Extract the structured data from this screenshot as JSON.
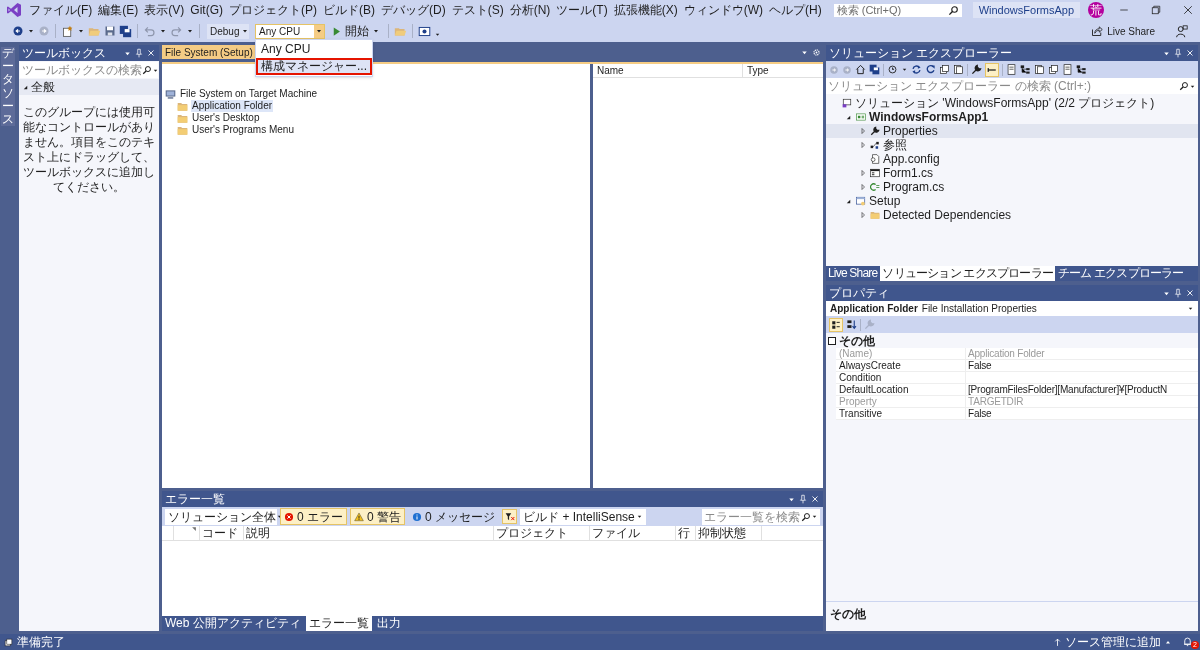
{
  "title_bar": {
    "menu": [
      "ファイル(F)",
      "編集(E)",
      "表示(V)",
      "Git(G)",
      "プロジェクト(P)",
      "ビルド(B)",
      "デバッグ(D)",
      "テスト(S)",
      "分析(N)",
      "ツール(T)",
      "拡張機能(X)",
      "ウィンドウ(W)",
      "ヘルプ(H)"
    ],
    "search_placeholder": "検索 (Ctrl+Q)",
    "solution_name": "WindowsFormsApp",
    "avatar": "荒"
  },
  "toolbar": {
    "configuration": "Debug",
    "platform": "Any CPU",
    "start": "開始",
    "live_share": "Live Share"
  },
  "platform_menu": [
    {
      "label": "Any CPU",
      "selected": false
    },
    {
      "label": "構成マネージャー...",
      "selected": true
    }
  ],
  "side_tab": "データソース",
  "toolbox": {
    "title": "ツールボックス",
    "search_placeholder": "ツールボックスの検索",
    "group": "全般",
    "message": "このグループには使用可能なコントロールがありません。項目をこのテキスト上にドラッグして、ツールボックスに追加してください。"
  },
  "document": {
    "tab": "File System (Setup)",
    "tree": {
      "label": "File System on Target Machine",
      "kind": "computer",
      "selected": false,
      "children": [
        {
          "label": "Application Folder",
          "kind": "folder",
          "selected": true
        },
        {
          "label": "User's Desktop",
          "kind": "folder",
          "selected": false
        },
        {
          "label": "User's Programs Menu",
          "kind": "folder",
          "selected": false
        }
      ]
    },
    "columns": [
      "Name",
      "Type"
    ]
  },
  "error_list": {
    "title": "エラー一覧",
    "scope": "ソリューション全体",
    "filters": [
      {
        "kind": "error",
        "label": "0 エラー",
        "on": true
      },
      {
        "kind": "warning",
        "label": "0 警告",
        "on": true
      },
      {
        "kind": "info",
        "label": "0 メッセージ",
        "on": false
      }
    ],
    "filter_on": true,
    "source": "ビルド + IntelliSense",
    "search_placeholder": "エラー一覧を検索",
    "columns": [
      "コード",
      "説明",
      "プロジェクト",
      "ファイル",
      "行",
      "抑制状態"
    ],
    "tabs": [
      {
        "label": "Web 公開アクティビティ",
        "selected": false
      },
      {
        "label": "エラー一覧",
        "selected": true
      },
      {
        "label": "出力",
        "selected": false
      }
    ]
  },
  "solution_explorer": {
    "title": "ソリューション エクスプローラー",
    "search_placeholder": "ソリューション エクスプローラー の検索 (Ctrl+:)",
    "preview_on": true,
    "tree": [
      {
        "label": "ソリューション 'WindowsFormsApp' (2/2 プロジェクト)",
        "kind": "solution",
        "selected": false,
        "children": [
          {
            "label": "WindowsFormsApp1",
            "kind": "csproj",
            "bold": true,
            "expanded": true,
            "selected": false,
            "children": [
              {
                "label": "Properties",
                "kind": "wrench",
                "expanded": false,
                "selected": true
              },
              {
                "label": "参照",
                "kind": "refs",
                "expanded": false,
                "selected": false
              },
              {
                "label": "App.config",
                "kind": "config",
                "selected": false
              },
              {
                "label": "Form1.cs",
                "kind": "form",
                "expanded": false,
                "selected": false
              },
              {
                "label": "Program.cs",
                "kind": "cs",
                "expanded": false,
                "selected": false
              }
            ]
          },
          {
            "label": "Setup",
            "kind": "setup",
            "expanded": true,
            "selected": false,
            "children": [
              {
                "label": "Detected Dependencies",
                "kind": "folder",
                "expanded": false,
                "selected": false
              }
            ]
          }
        ]
      }
    ],
    "tabs": [
      {
        "label": "Live Share",
        "selected": false
      },
      {
        "label": "ソリューション エクスプローラー",
        "selected": true
      },
      {
        "label": "チーム エクスプローラー",
        "selected": false
      }
    ]
  },
  "properties": {
    "title": "プロパティ",
    "object": "Application Folder",
    "object_type": "File Installation Properties",
    "categorized_on": true,
    "category": "その他",
    "rows": [
      {
        "name": "(Name)",
        "value": "Application Folder",
        "disabled": true
      },
      {
        "name": "AlwaysCreate",
        "value": "False",
        "disabled": false
      },
      {
        "name": "Condition",
        "disabled": false
      },
      {
        "name": "DefaultLocation",
        "value": "[ProgramFilesFolder][Manufacturer]¥[ProductN",
        "disabled": false
      },
      {
        "name": "Property",
        "value": "TARGETDIR",
        "disabled": true
      },
      {
        "name": "Transitive",
        "value": "False",
        "disabled": false
      }
    ],
    "description": "その他"
  },
  "status_bar": {
    "left": "準備完了",
    "source_control": "ソース管理に追加",
    "notifications": "2"
  }
}
